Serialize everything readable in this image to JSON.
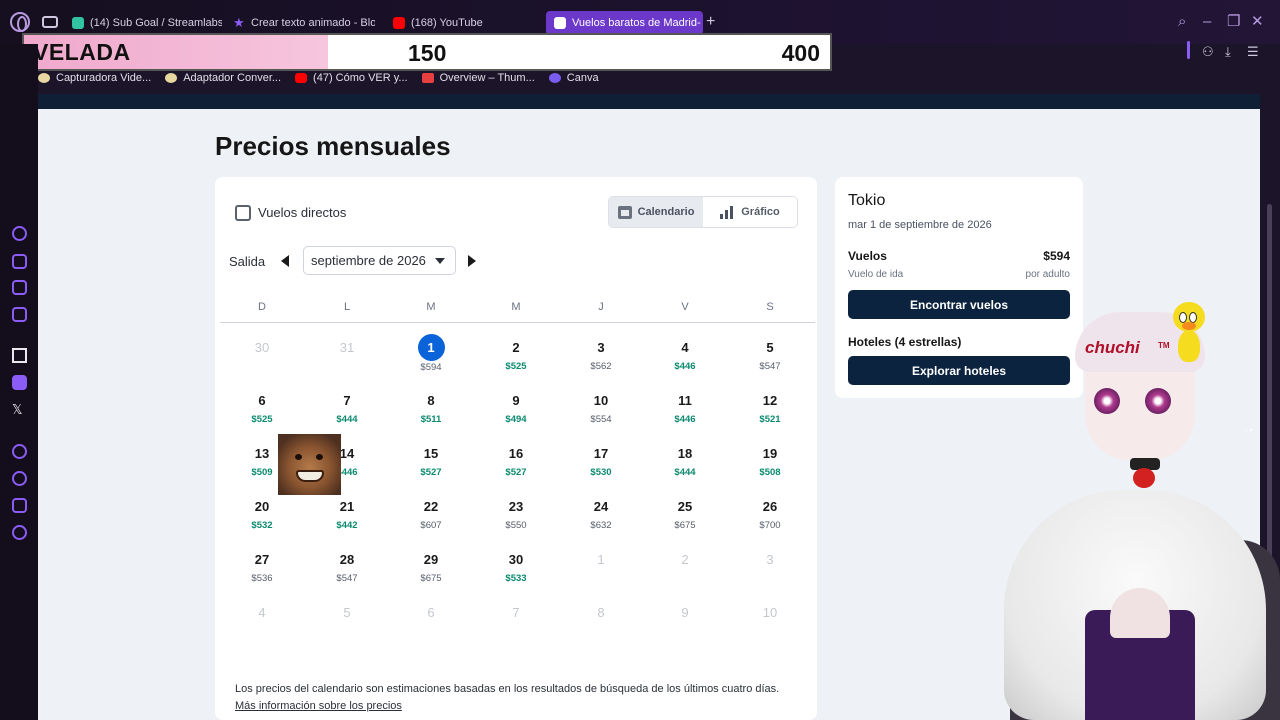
{
  "browser": {
    "tabs": [
      {
        "label": "(14) Sub Goal / Streamlabs",
        "color": "#31c3a2"
      },
      {
        "label": "Crear texto animado - Blog",
        "color": "#8b5cf6"
      },
      {
        "label": "(168) YouTube",
        "color": "#ff0000"
      },
      {
        "label": "Vuelos baratos de Madrid-",
        "color": "#ffffff"
      }
    ],
    "new_tab_symbol": "+"
  },
  "overlay": {
    "label": "VELADA",
    "current": "150",
    "goal": "400"
  },
  "bookmarks": [
    {
      "label": "Capturadora Vide...",
      "icon": "pill-icon",
      "color": "#e8d7a0"
    },
    {
      "label": "Adaptador Conver...",
      "icon": "pill-icon",
      "color": "#e8d7a0"
    },
    {
      "label": "(47) Cómo VER y...",
      "icon": "youtube-icon",
      "color": "#ff0000"
    },
    {
      "label": "Overview – Thum...",
      "icon": "overview-icon",
      "color": "#e84040"
    },
    {
      "label": "Canva",
      "icon": "canva-icon",
      "color": "#7a5cf0"
    }
  ],
  "page": {
    "title": "Precios mensuales"
  },
  "calendar": {
    "direct_flights_label": "Vuelos directos",
    "view_options": [
      "Calendario",
      "Gráfico"
    ],
    "active_view": "Calendario",
    "salida_label": "Salida",
    "month": "septiembre de 2026",
    "weekdays": [
      "D",
      "L",
      "M",
      "M",
      "J",
      "V",
      "S"
    ],
    "rows": [
      [
        {
          "d": "30",
          "m": true
        },
        {
          "d": "31",
          "m": true
        },
        {
          "d": "1",
          "p": "$594",
          "sel": true
        },
        {
          "d": "2",
          "p": "$525",
          "g": true
        },
        {
          "d": "3",
          "p": "$562"
        },
        {
          "d": "4",
          "p": "$446",
          "g": true
        },
        {
          "d": "5",
          "p": "$547"
        }
      ],
      [
        {
          "d": "6",
          "p": "$525",
          "g": true
        },
        {
          "d": "7",
          "p": "$444",
          "g": true
        },
        {
          "d": "8",
          "p": "$511",
          "g": true
        },
        {
          "d": "9",
          "p": "$494",
          "g": true
        },
        {
          "d": "10",
          "p": "$554"
        },
        {
          "d": "11",
          "p": "$446",
          "g": true
        },
        {
          "d": "12",
          "p": "$521",
          "g": true
        }
      ],
      [
        {
          "d": "13",
          "p": "$509",
          "g": true
        },
        {
          "d": "14",
          "p": "$446",
          "g": true
        },
        {
          "d": "15",
          "p": "$527",
          "g": true
        },
        {
          "d": "16",
          "p": "$527",
          "g": true
        },
        {
          "d": "17",
          "p": "$530",
          "g": true
        },
        {
          "d": "18",
          "p": "$444",
          "g": true
        },
        {
          "d": "19",
          "p": "$508",
          "g": true
        }
      ],
      [
        {
          "d": "20",
          "p": "$532",
          "g": true
        },
        {
          "d": "21",
          "p": "$442",
          "g": true
        },
        {
          "d": "22",
          "p": "$607"
        },
        {
          "d": "23",
          "p": "$550"
        },
        {
          "d": "24",
          "p": "$632"
        },
        {
          "d": "25",
          "p": "$675"
        },
        {
          "d": "26",
          "p": "$700"
        }
      ],
      [
        {
          "d": "27",
          "p": "$536"
        },
        {
          "d": "28",
          "p": "$547"
        },
        {
          "d": "29",
          "p": "$675"
        },
        {
          "d": "30",
          "p": "$533",
          "g": true
        },
        {
          "d": "1",
          "m": true
        },
        {
          "d": "2",
          "m": true
        },
        {
          "d": "3",
          "m": true
        }
      ],
      [
        {
          "d": "4",
          "m": true
        },
        {
          "d": "5",
          "m": true
        },
        {
          "d": "6",
          "m": true
        },
        {
          "d": "7",
          "m": true
        },
        {
          "d": "8",
          "m": true
        },
        {
          "d": "9",
          "m": true
        },
        {
          "d": "10",
          "m": true
        }
      ]
    ],
    "note": "Los precios del calendario son estimaciones basadas en los resultados de búsqueda de los últimos cuatro días.",
    "note_link": "Más información sobre los precios"
  },
  "side_card": {
    "destination": "Tokio",
    "date": "mar 1 de septiembre de 2026",
    "flights_label": "Vuelos",
    "flights_price": "$594",
    "flights_sub": "Vuelo de ida",
    "per_adult": "por adulto",
    "find_flights_button": "Encontrar vuelos",
    "hotels_label": "Hoteles (4 estrellas)",
    "explore_hotels_button": "Explorar hoteles"
  },
  "stream": {
    "signature": "chuchi",
    "signature_tm": "TM"
  },
  "colors": {
    "accent_purple": "#6b38c9",
    "price_good": "#0b8a6f",
    "selected_day": "#0a63d8",
    "button_dark": "#0c2340"
  }
}
